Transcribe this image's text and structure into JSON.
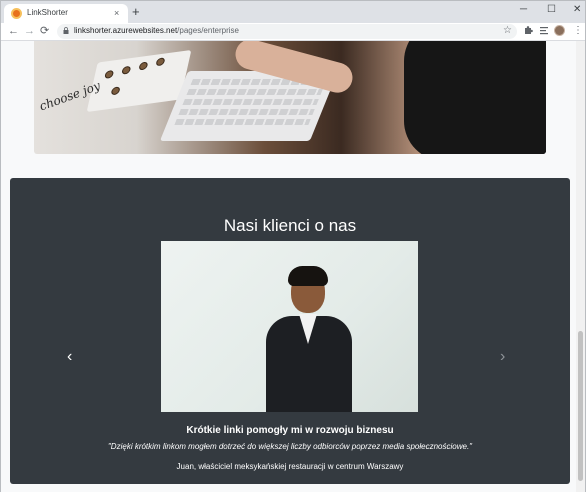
{
  "browser": {
    "tab_title": "LinkShorter",
    "tab_close": "×",
    "new_tab": "+",
    "minimize": "─",
    "maximize": "☐",
    "close": "✕",
    "back": "←",
    "forward": "→",
    "reload": "⟳",
    "url_host": "linkshorter.azurewebsites.net",
    "url_path": "/pages/enterprise",
    "star": "☆",
    "menu": "⋮"
  },
  "hero": {
    "image_text": "choose joy"
  },
  "testimonials": {
    "title": "Nasi klienci o nas",
    "prev": "‹",
    "next": "›",
    "slide": {
      "heading": "Krótkie linki pomogły mi w rozwoju biznesu",
      "quote": "\"Dzięki krótkim linkom mogłem dotrzeć do większej liczby odbiorców poprzez media społecznościowe.\"",
      "author": "Juan, właściciel meksykańskiej restauracji w centrum Warszawy"
    }
  },
  "colors": {
    "section_bg": "#343a40",
    "page_bg": "#f8f9fa",
    "tabstrip_bg": "#dee1e6"
  }
}
